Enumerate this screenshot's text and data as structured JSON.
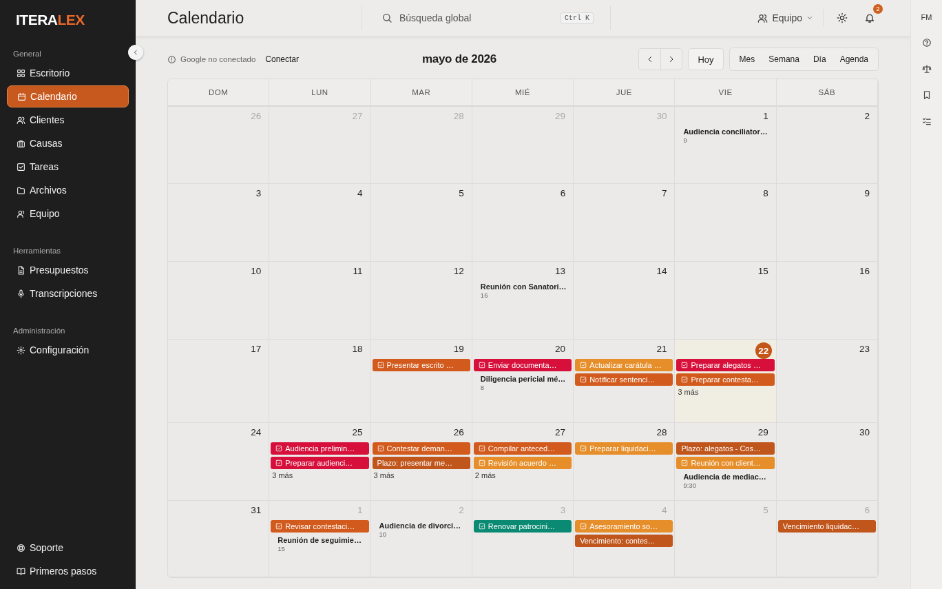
{
  "logo": {
    "part_1": "ITERA",
    "part_2": "LEX"
  },
  "sidebar": {
    "groups": [
      {
        "heading": "General",
        "items": [
          {
            "label": "Escritorio",
            "selected": false
          },
          {
            "label": "Calendario",
            "selected": true
          },
          {
            "label": "Clientes",
            "selected": false
          },
          {
            "label": "Causas",
            "selected": false
          },
          {
            "label": "Tareas",
            "selected": false
          },
          {
            "label": "Archivos",
            "selected": false
          },
          {
            "label": "Equipo",
            "selected": false
          }
        ]
      },
      {
        "heading": "Herramientas",
        "items": [
          {
            "label": "Presupuestos",
            "selected": false
          },
          {
            "label": "Transcripciones",
            "selected": false
          }
        ]
      },
      {
        "heading": "Administración",
        "items": [
          {
            "label": "Configuración",
            "selected": false
          }
        ]
      }
    ],
    "footer_items": [
      {
        "label": "Soporte"
      },
      {
        "label": "Primeros pasos"
      }
    ]
  },
  "header": {
    "title": "Calendario",
    "search": {
      "placeholder": "Búsqueda global",
      "shortcut": "Ctrl K"
    },
    "team": "Equipo",
    "notifications": "2"
  },
  "toolbar": {
    "google_status": "Google no conectado",
    "connect": "Conectar",
    "month": "mayo de 2026",
    "today": "Hoy",
    "views": [
      "Mes",
      "Semana",
      "Día",
      "Agenda"
    ]
  },
  "calendar": {
    "weekdays": [
      "DOM",
      "LUN",
      "MAR",
      "MIÉ",
      "JUE",
      "VIE",
      "SÁB"
    ],
    "weeks": [
      {
        "days": [
          {
            "number": "26",
            "outside": true,
            "today": false
          },
          {
            "number": "27",
            "outside": true,
            "today": false
          },
          {
            "number": "28",
            "outside": true,
            "today": false
          },
          {
            "number": "29",
            "outside": true,
            "today": false
          },
          {
            "number": "30",
            "outside": true,
            "today": false
          },
          {
            "number": "1",
            "outside": false,
            "today": false,
            "events": [
              {
                "kind": "event",
                "title": "Audiencia conciliator…",
                "time": "9"
              }
            ]
          },
          {
            "number": "2",
            "outside": false,
            "today": false
          }
        ]
      },
      {
        "days": [
          {
            "number": "3",
            "outside": false,
            "today": false
          },
          {
            "number": "4",
            "outside": false,
            "today": false
          },
          {
            "number": "5",
            "outside": false,
            "today": false
          },
          {
            "number": "6",
            "outside": false,
            "today": false
          },
          {
            "number": "7",
            "outside": false,
            "today": false
          },
          {
            "number": "8",
            "outside": false,
            "today": false
          },
          {
            "number": "9",
            "outside": false,
            "today": false
          }
        ]
      },
      {
        "days": [
          {
            "number": "10",
            "outside": false,
            "today": false
          },
          {
            "number": "11",
            "outside": false,
            "today": false
          },
          {
            "number": "12",
            "outside": false,
            "today": false
          },
          {
            "number": "13",
            "outside": false,
            "today": false,
            "events": [
              {
                "kind": "event",
                "title": "Reunión con Sanatori…",
                "time": "16"
              }
            ]
          },
          {
            "number": "14",
            "outside": false,
            "today": false
          },
          {
            "number": "15",
            "outside": false,
            "today": false
          },
          {
            "number": "16",
            "outside": false,
            "today": false
          }
        ]
      },
      {
        "days": [
          {
            "number": "17",
            "outside": false,
            "today": false
          },
          {
            "number": "18",
            "outside": false,
            "today": false
          },
          {
            "number": "19",
            "outside": false,
            "today": false,
            "events": [
              {
                "kind": "task",
                "title": "Presentar escrito …",
                "color": "#d25a1c"
              }
            ]
          },
          {
            "number": "20",
            "outside": false,
            "today": false,
            "events": [
              {
                "kind": "task",
                "title": "Enviar documenta…",
                "color": "#d6103a"
              },
              {
                "kind": "event",
                "title": "Diligencia pericial mé…",
                "time": "8"
              }
            ]
          },
          {
            "number": "21",
            "outside": false,
            "today": false,
            "events": [
              {
                "kind": "task",
                "title": "Actualizar carátula …",
                "color": "#e68e2a"
              },
              {
                "kind": "task",
                "title": "Notificar sentenci…",
                "color": "#d25a1c"
              }
            ]
          },
          {
            "number": "22",
            "outside": false,
            "today": true,
            "events": [
              {
                "kind": "task",
                "title": "Preparar alegatos …",
                "color": "#d6103a"
              },
              {
                "kind": "task",
                "title": "Preparar contesta…",
                "color": "#d25a1c"
              }
            ],
            "more": "3 más"
          },
          {
            "number": "23",
            "outside": false,
            "today": false
          }
        ]
      },
      {
        "days": [
          {
            "number": "24",
            "outside": false,
            "today": false
          },
          {
            "number": "25",
            "outside": false,
            "today": false,
            "events": [
              {
                "kind": "task",
                "title": "Audiencia prelimin…",
                "color": "#d6103a"
              },
              {
                "kind": "task",
                "title": "Preparar audienci…",
                "color": "#d6103a"
              }
            ],
            "more": "3 más"
          },
          {
            "number": "26",
            "outside": false,
            "today": false,
            "events": [
              {
                "kind": "task",
                "title": "Contestar deman…",
                "color": "#d25a1c"
              },
              {
                "kind": "deadline",
                "title": "Plazo: presentar me…",
                "color": "#c0561c"
              }
            ],
            "more": "3 más"
          },
          {
            "number": "27",
            "outside": false,
            "today": false,
            "events": [
              {
                "kind": "task",
                "title": "Compilar anteced…",
                "color": "#d25a1c"
              },
              {
                "kind": "task",
                "title": "Revisión acuerdo …",
                "color": "#e68e2a"
              }
            ],
            "more": "2 más"
          },
          {
            "number": "28",
            "outside": false,
            "today": false,
            "events": [
              {
                "kind": "task",
                "title": "Preparar liquidaci…",
                "color": "#e68e2a"
              }
            ]
          },
          {
            "number": "29",
            "outside": false,
            "today": false,
            "events": [
              {
                "kind": "deadline",
                "title": "Plazo: alegatos - Cos…",
                "color": "#c0561c"
              },
              {
                "kind": "task",
                "title": "Reunión con client…",
                "color": "#e68e2a"
              },
              {
                "kind": "event",
                "title": "Audiencia de mediac…",
                "time": "9:30"
              }
            ]
          },
          {
            "number": "30",
            "outside": false,
            "today": false
          }
        ]
      },
      {
        "days": [
          {
            "number": "31",
            "outside": false,
            "today": false
          },
          {
            "number": "1",
            "outside": true,
            "today": false,
            "events": [
              {
                "kind": "task",
                "title": "Revisar contestaci…",
                "color": "#d25a1c"
              },
              {
                "kind": "event",
                "title": "Reunión de seguimie…",
                "time": "15"
              }
            ]
          },
          {
            "number": "2",
            "outside": true,
            "today": false,
            "events": [
              {
                "kind": "event",
                "title": "Audiencia de divorci…",
                "time": "10"
              }
            ]
          },
          {
            "number": "3",
            "outside": true,
            "today": false,
            "events": [
              {
                "kind": "task",
                "title": "Renovar patrocini…",
                "color": "#0b8a73"
              }
            ]
          },
          {
            "number": "4",
            "outside": true,
            "today": false,
            "events": [
              {
                "kind": "task",
                "title": "Asesoramiento so…",
                "color": "#e68e2a"
              },
              {
                "kind": "deadline",
                "title": "Vencimiento: contes…",
                "color": "#c0561c"
              }
            ]
          },
          {
            "number": "5",
            "outside": true,
            "today": false
          },
          {
            "number": "6",
            "outside": true,
            "today": false,
            "events": [
              {
                "kind": "deadline",
                "title": "Vencimiento liquidac…",
                "color": "#c0561c"
              }
            ]
          }
        ]
      }
    ]
  },
  "rail": {
    "initials": "FM"
  }
}
